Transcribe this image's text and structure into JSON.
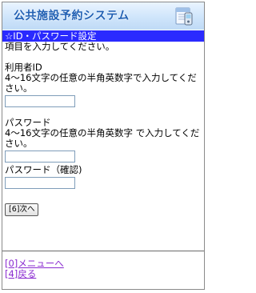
{
  "header": {
    "title": "公共施設予約システム",
    "icon": "phone-calendar-icon"
  },
  "section": {
    "title": "☆ID・パスワード設定"
  },
  "form": {
    "intro": "項目を入力してください。",
    "user_id": {
      "label": "利用者ID",
      "hint": "4〜16文字の任意の半角英数字で入力してください。",
      "value": ""
    },
    "password": {
      "label": "パスワード",
      "hint": "4〜16文字の任意の半角英数字 で入力してください。",
      "value": ""
    },
    "password_confirm": {
      "label": "パスワード（確認)",
      "value": ""
    },
    "next_button_label": "[6]次へ"
  },
  "links": {
    "menu": "[0]メニューへ",
    "back": "[4]戻る"
  },
  "colors": {
    "section_bar": "#2a2aff",
    "title_text": "#1f5fb3",
    "link": "#8a2bd0"
  }
}
